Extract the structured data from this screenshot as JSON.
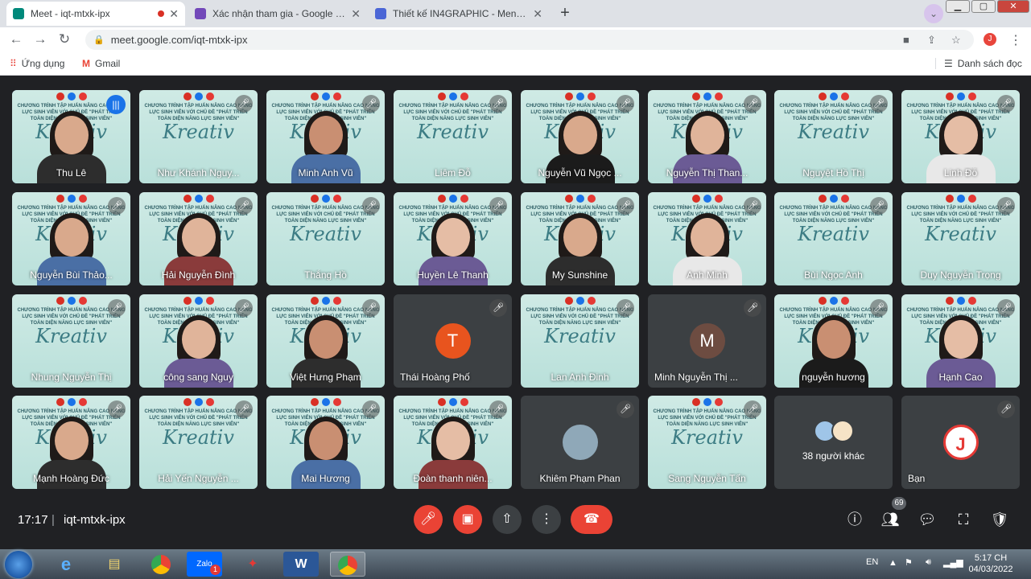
{
  "browser": {
    "tabs": [
      {
        "title": "Meet - iqt-mtxk-ipx",
        "active": true,
        "favicon_color": "#00897b"
      },
      {
        "title": "Xác nhận tham gia - Google Biểu",
        "active": false,
        "favicon_color": "#7248b9"
      },
      {
        "title": "Thiết kế IN4GRAPHIC - Mentimet",
        "active": false,
        "favicon_color": "#4b66d6"
      }
    ],
    "new_tab": "+",
    "url": "meet.google.com/iqt-mtxk-ipx",
    "bookmarks": [
      {
        "label": "Ứng dụng",
        "icon": "apps-grid-icon"
      },
      {
        "label": "Gmail",
        "icon": "gmail-icon"
      }
    ],
    "reading_list": "Danh sách đọc"
  },
  "meet": {
    "slide_brand": "Kreativ",
    "slide_heading": "CHƯƠNG TRÌNH TẬP HUẤN NÂNG CAO NĂNG LỰC SINH VIÊN VỚI CHỦ ĐỀ \"PHÁT TRIỂN TOÀN DIỆN NĂNG LỰC SINH VIÊN\"",
    "participants": [
      {
        "name": "Thu Lê",
        "type": "person",
        "speaking": true
      },
      {
        "name": "Như Khánh Nguy...",
        "type": "slide"
      },
      {
        "name": "Minh Anh Vũ",
        "type": "person"
      },
      {
        "name": "Liêm Đỗ",
        "type": "slide"
      },
      {
        "name": "Nguyễn Vũ Ngọc ...",
        "type": "person"
      },
      {
        "name": "Nguyễn Thị Than...",
        "type": "person"
      },
      {
        "name": "Nguyệt Hồ Thị",
        "type": "slide"
      },
      {
        "name": "Linh Đỗ",
        "type": "person"
      },
      {
        "name": "Nguyễn Bùi Thảo...",
        "type": "person"
      },
      {
        "name": "Hải Nguyễn Đình",
        "type": "person"
      },
      {
        "name": "Thắng Hồ",
        "type": "slide"
      },
      {
        "name": "Huyền Lê Thanh",
        "type": "person"
      },
      {
        "name": "My Sunshine",
        "type": "person"
      },
      {
        "name": "Anh Minh",
        "type": "person"
      },
      {
        "name": "Bùi Ngọc Anh",
        "type": "slide"
      },
      {
        "name": "Duy Nguyễn Trọng",
        "type": "slide"
      },
      {
        "name": "Nhung Nguyễn Thị",
        "type": "slide"
      },
      {
        "name": "công sang Nguy",
        "type": "person"
      },
      {
        "name": "Việt Hưng Phạm",
        "type": "person"
      },
      {
        "name": "Thái Hoàng Phố",
        "type": "avatar",
        "initial": "T",
        "color": "#e8541e"
      },
      {
        "name": "Lan Anh Đinh",
        "type": "slide"
      },
      {
        "name": "Minh Nguyễn Thị ...",
        "type": "avatar",
        "initial": "M",
        "color": "#6d4c41"
      },
      {
        "name": "nguyễn hương",
        "type": "person"
      },
      {
        "name": "Hạnh Cao",
        "type": "person"
      },
      {
        "name": "Mạnh Hoàng Đức",
        "type": "person"
      },
      {
        "name": "Hải Yến Nguyễn ...",
        "type": "slide"
      },
      {
        "name": "Mai Hương",
        "type": "person"
      },
      {
        "name": "Đoàn thanh niên...",
        "type": "person"
      },
      {
        "name": "Khiêm Phạm Phan",
        "type": "avatar",
        "initial": "",
        "color": "#8fa8b8"
      },
      {
        "name": "Sang Nguyễn Tấn",
        "type": "slide"
      },
      {
        "name": "38 người khác",
        "type": "others"
      },
      {
        "name": "Bạn",
        "type": "self"
      }
    ],
    "time": "17:17",
    "meeting_code": "iqt-mtxk-ipx",
    "participant_count": "69"
  },
  "taskbar": {
    "language": "EN",
    "clock_time": "5:17 CH",
    "clock_date": "04/03/2022",
    "zalo_badge": "1"
  }
}
